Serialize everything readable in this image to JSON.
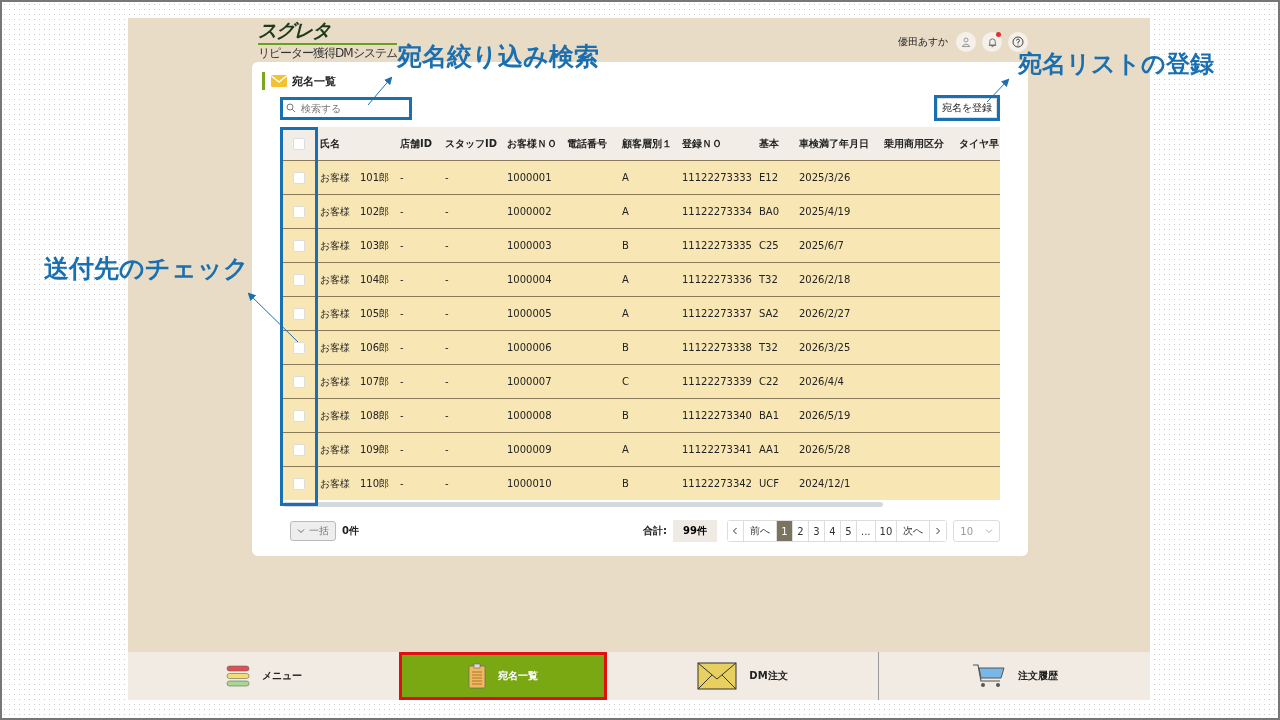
{
  "header": {
    "logo": "スグレタ",
    "logo_sub": "リピーター獲得DMシステム",
    "user_name": "優田あすか",
    "notification_unread": true
  },
  "panel": {
    "title": "宛名一覧",
    "search": {
      "placeholder": "検索する"
    },
    "register_button": "宛名を登録"
  },
  "table": {
    "all_checked": false,
    "columns": [
      "氏名",
      "店舗ID",
      "スタッフID",
      "お客様ＮＯ",
      "電話番号",
      "顧客層別１",
      "登録ＮＯ",
      "基本",
      "車検満了年月日",
      "乗用商用区分",
      "タイヤ早"
    ],
    "rows": [
      {
        "checked": false,
        "cells": [
          "お客様　101郎",
          "-",
          "-",
          "1000001",
          null,
          "A",
          "11122273333",
          "E12",
          "2025/3/26",
          null,
          null
        ]
      },
      {
        "checked": false,
        "cells": [
          "お客様　102郎",
          "-",
          "-",
          "1000002",
          null,
          "A",
          "11122273334",
          "BA0",
          "2025/4/19",
          null,
          null
        ]
      },
      {
        "checked": false,
        "cells": [
          "お客様　103郎",
          "-",
          "-",
          "1000003",
          null,
          "B",
          "11122273335",
          "C25",
          "2025/6/7",
          null,
          null
        ]
      },
      {
        "checked": false,
        "cells": [
          "お客様　104郎",
          "-",
          "-",
          "1000004",
          null,
          "A",
          "11122273336",
          "T32",
          "2026/2/18",
          null,
          null
        ]
      },
      {
        "checked": false,
        "cells": [
          "お客様　105郎",
          "-",
          "-",
          "1000005",
          null,
          "A",
          "11122273337",
          "SA2",
          "2026/2/27",
          null,
          null
        ]
      },
      {
        "checked": false,
        "cells": [
          "お客様　106郎",
          "-",
          "-",
          "1000006",
          null,
          "B",
          "11122273338",
          "T32",
          "2026/3/25",
          null,
          null
        ]
      },
      {
        "checked": false,
        "cells": [
          "お客様　107郎",
          "-",
          "-",
          "1000007",
          null,
          "C",
          "11122273339",
          "C22",
          "2026/4/4",
          null,
          null
        ]
      },
      {
        "checked": false,
        "cells": [
          "お客様　108郎",
          "-",
          "-",
          "1000008",
          null,
          "B",
          "11122273340",
          "BA1",
          "2026/5/19",
          null,
          null
        ]
      },
      {
        "checked": false,
        "cells": [
          "お客様　109郎",
          "-",
          "-",
          "1000009",
          null,
          "A",
          "11122273341",
          "AA1",
          "2026/5/28",
          null,
          null
        ]
      },
      {
        "checked": false,
        "cells": [
          "お客様　110郎",
          "-",
          "-",
          "1000010",
          null,
          "B",
          "11122273342",
          "UCF",
          "2024/12/1",
          null,
          null
        ]
      }
    ]
  },
  "footer": {
    "bulk_button": "一括",
    "selected_count": "0件",
    "total_label": "合計:",
    "total": "99件",
    "prev": "前へ",
    "next": "次へ",
    "pages": [
      {
        "label": "1",
        "selected": true
      },
      {
        "label": "2",
        "selected": false
      },
      {
        "label": "3",
        "selected": false
      },
      {
        "label": "4",
        "selected": false
      },
      {
        "label": "5",
        "selected": false
      },
      {
        "label": "...",
        "selected": false
      },
      {
        "label": "10",
        "selected": false
      }
    ],
    "page_size": "10"
  },
  "bottom_nav": [
    {
      "label": "メニュー",
      "kind": "menu",
      "selected": false
    },
    {
      "label": "宛名一覧",
      "kind": "list",
      "selected": true
    },
    {
      "label": "DM注文",
      "kind": "mail",
      "selected": false
    },
    {
      "label": "注文履歴",
      "kind": "cart",
      "selected": false
    }
  ],
  "annotations": [
    "宛名絞り込み検索",
    "宛名リストの登録",
    "送付先のチェック"
  ]
}
